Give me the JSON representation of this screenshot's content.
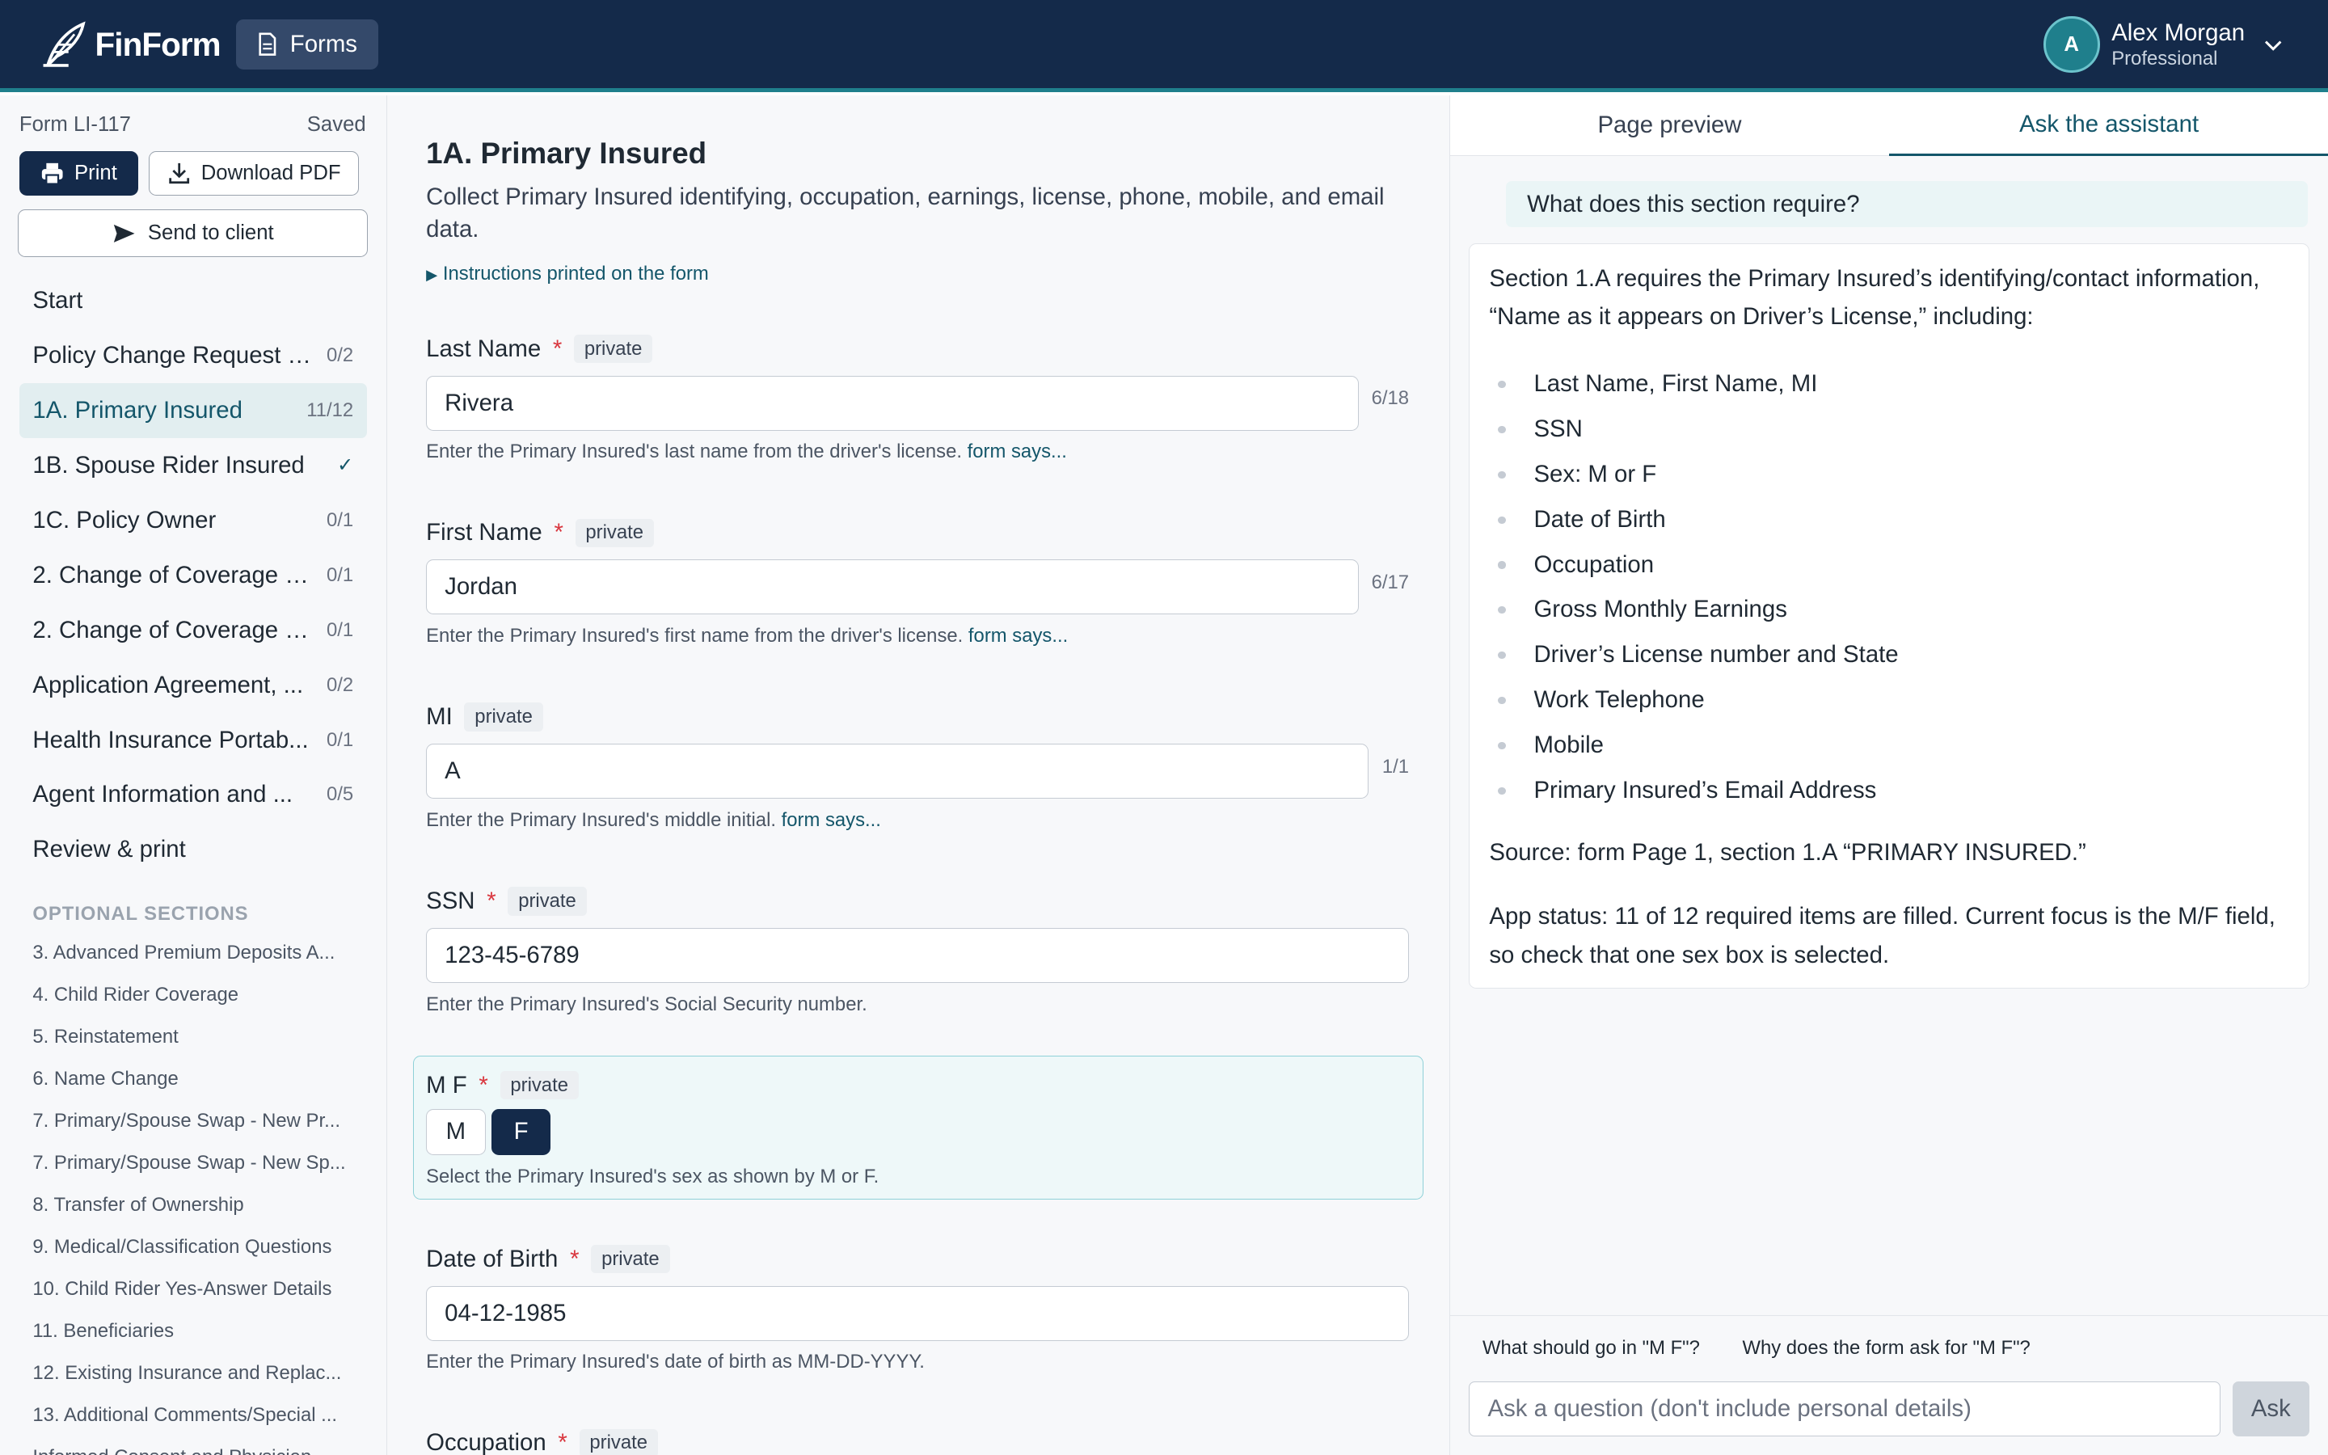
{
  "header": {
    "logo_text": "FinForm",
    "forms_label": "Forms",
    "user": {
      "initial": "A",
      "name": "Alex Morgan",
      "role": "Professional"
    }
  },
  "sidebar": {
    "form_id": "Form LI-117",
    "save_status": "Saved",
    "print_label": "Print",
    "download_label": "Download PDF",
    "send_label": "Send to client",
    "items": [
      {
        "label": "Start",
        "count": ""
      },
      {
        "label": "Policy Change Request a...",
        "count": "0/2"
      },
      {
        "label": "1A. Primary Insured",
        "count": "11/12"
      },
      {
        "label": "1B. Spouse Rider Insured",
        "count": "✓"
      },
      {
        "label": "1C. Policy Owner",
        "count": "0/1"
      },
      {
        "label": "2. Change of Coverage - ...",
        "count": "0/1"
      },
      {
        "label": "2. Change of Coverage - ...",
        "count": "0/1"
      },
      {
        "label": "Application Agreement, ...",
        "count": "0/2"
      },
      {
        "label": "Health Insurance Portab...",
        "count": "0/1"
      },
      {
        "label": "Agent Information and ...",
        "count": "0/5"
      },
      {
        "label": "Review & print",
        "count": ""
      }
    ],
    "optional_title": "OPTIONAL SECTIONS",
    "optional_items": [
      "3. Advanced Premium Deposits A...",
      "4. Child Rider Coverage",
      "5. Reinstatement",
      "6. Name Change",
      "7. Primary/Spouse Swap - New Pr...",
      "7. Primary/Spouse Swap - New Sp...",
      "8. Transfer of Ownership",
      "9. Medical/Classification Questions",
      "10. Child Rider Yes-Answer Details",
      "11. Beneficiaries",
      "12. Existing Insurance and Replac...",
      "13. Additional Comments/Special ...",
      "Informed Consent and Physician ..."
    ]
  },
  "main": {
    "title": "1A. Primary Insured",
    "description": "Collect Primary Insured identifying, occupation, earnings, license, phone, mobile, and email data.",
    "instructions_label": "Instructions printed on the form",
    "private_tag": "private",
    "required_mark": "*",
    "form_says": "form says...",
    "fields": {
      "last_name": {
        "label": "Last Name",
        "value": "Rivera",
        "count": "6/18",
        "help": "Enter the Primary Insured's last name from the driver's license."
      },
      "first_name": {
        "label": "First Name",
        "value": "Jordan",
        "count": "6/17",
        "help": "Enter the Primary Insured's first name from the driver's license."
      },
      "mi": {
        "label": "MI",
        "value": "A",
        "count": "1/1",
        "help": "Enter the Primary Insured's middle initial."
      },
      "ssn": {
        "label": "SSN",
        "value": "123-45-6789",
        "help": "Enter the Primary Insured's Social Security number."
      },
      "mf": {
        "label": "M F",
        "options": [
          "M",
          "F"
        ],
        "selected": "F",
        "help": "Select the Primary Insured's sex as shown by M or F."
      },
      "dob": {
        "label": "Date of Birth",
        "value": "04-12-1985",
        "help": "Enter the Primary Insured's date of birth as MM-DD-YYYY."
      },
      "occupation": {
        "label": "Occupation"
      }
    }
  },
  "assistant": {
    "tabs": [
      "Page preview",
      "Ask the assistant"
    ],
    "active_tab": "Ask the assistant",
    "question": "What does this section require?",
    "answer_intro": "Section 1.A requires the Primary Insured’s identifying/contact information, “Name as it appears on Driver’s License,” including:",
    "answer_items": [
      "Last Name, First Name, MI",
      "SSN",
      "Sex: M or F",
      "Date of Birth",
      "Occupation",
      "Gross Monthly Earnings",
      "Driver’s License number and State",
      "Work Telephone",
      "Mobile",
      "Primary Insured’s Email Address"
    ],
    "answer_source": "Source: form Page 1, section 1.A “PRIMARY INSURED.”",
    "answer_status": "App status: 11 of 12 required items are filled. Current focus is the M/F field, so check that one sex box is selected.",
    "suggestions": [
      "What should go in \"M F\"?",
      "Why does the form ask for \"M F\"?"
    ],
    "input_placeholder": "Ask a question (don't include personal details)",
    "ask_label": "Ask"
  },
  "colors": {
    "header_bg": "#142a4a",
    "accent": "#14566a",
    "required": "#d9363e"
  }
}
